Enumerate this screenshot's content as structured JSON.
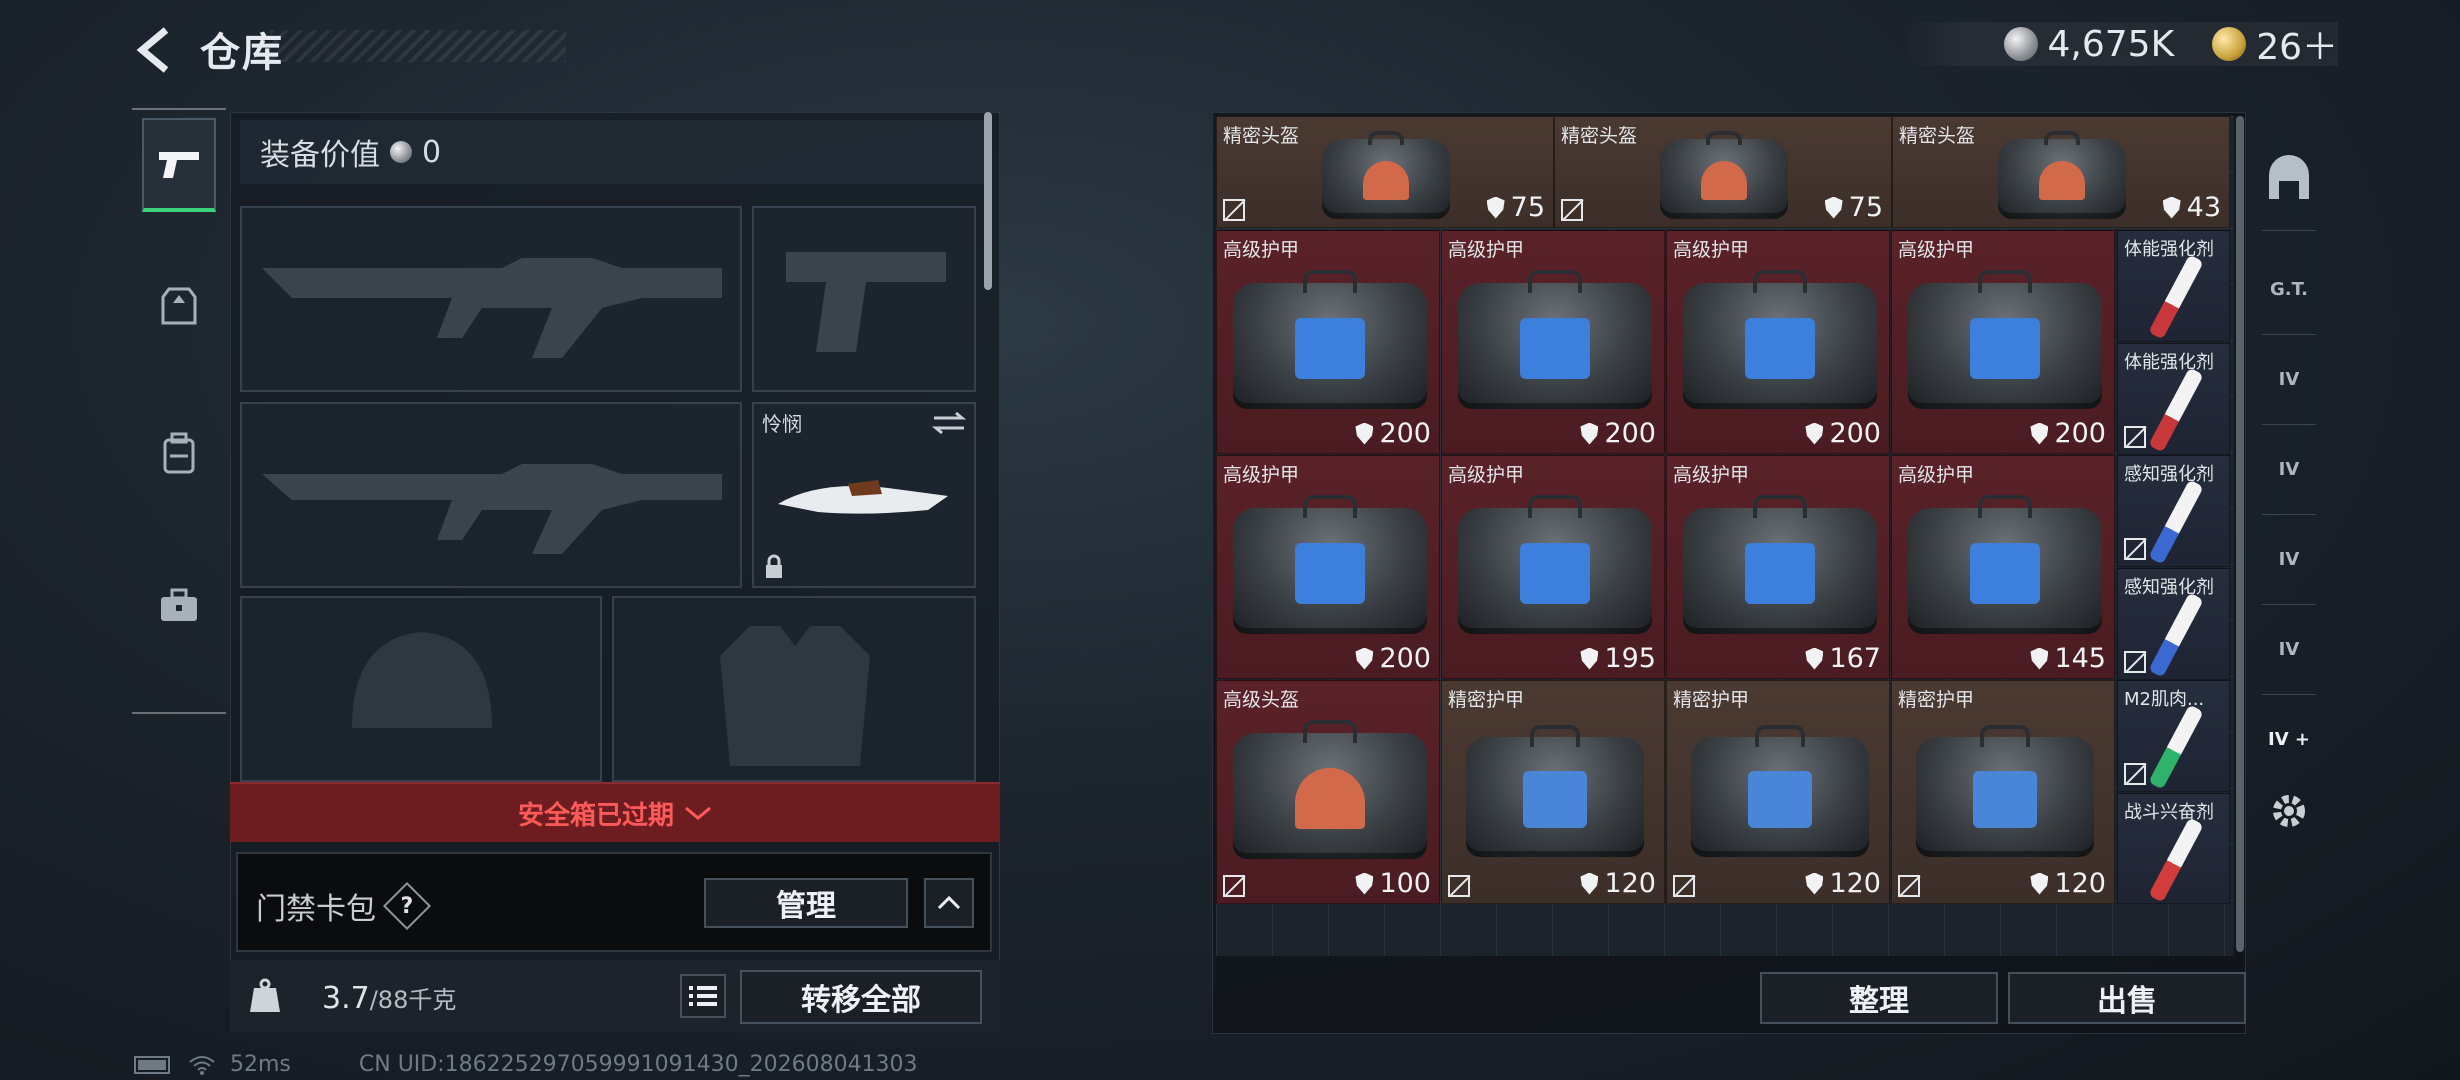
{
  "header": {
    "title": "仓库",
    "silver_amount": "4,675K",
    "gold_amount": "26＋"
  },
  "loadout": {
    "value_label": "装备价值",
    "value": "0",
    "melee_name": "怜悯",
    "safebox_warning": "安全箱已过期",
    "keycard_label": "门禁卡包",
    "manage_label": "管理",
    "weight_current": "3.7",
    "weight_capacity": "/88千克",
    "transfer_all_label": "转移全部"
  },
  "stash": {
    "row1": [
      {
        "name": "精密头盔",
        "durability": "75"
      },
      {
        "name": "精密头盔",
        "durability": "75"
      },
      {
        "name": "精密头盔",
        "durability": "43"
      }
    ],
    "armor_rows": [
      {
        "name": "高级护甲",
        "durability": "200"
      },
      {
        "name": "高级护甲",
        "durability": "200"
      },
      {
        "name": "高级护甲",
        "durability": "200"
      },
      {
        "name": "高级护甲",
        "durability": "200"
      },
      {
        "name": "高级护甲",
        "durability": "200"
      },
      {
        "name": "高级护甲",
        "durability": "195"
      },
      {
        "name": "高级护甲",
        "durability": "167"
      },
      {
        "name": "高级护甲",
        "durability": "145"
      }
    ],
    "row4": [
      {
        "name": "高级头盔",
        "durability": "100"
      },
      {
        "name": "精密护甲",
        "durability": "120"
      },
      {
        "name": "精密护甲",
        "durability": "120"
      },
      {
        "name": "精密护甲",
        "durability": "120"
      }
    ],
    "consumables": [
      "体能强化剂",
      "体能强化剂",
      "感知强化剂",
      "感知强化剂",
      "M2肌肉...",
      "战斗兴奋剂"
    ],
    "sort_label": "整理",
    "sell_label": "出售"
  },
  "sidebar_right": {
    "labels": [
      "G.T.",
      "IV",
      "IV",
      "IV",
      "IV",
      "IV"
    ]
  },
  "footer": {
    "ping": "52ms",
    "uid": "CN UID:1862252970599910914​30_202608041303"
  },
  "colors": {
    "accent_green": "#3ad37a",
    "warning_red": "#ff5a5a",
    "panel_red": "#6d1d20"
  }
}
